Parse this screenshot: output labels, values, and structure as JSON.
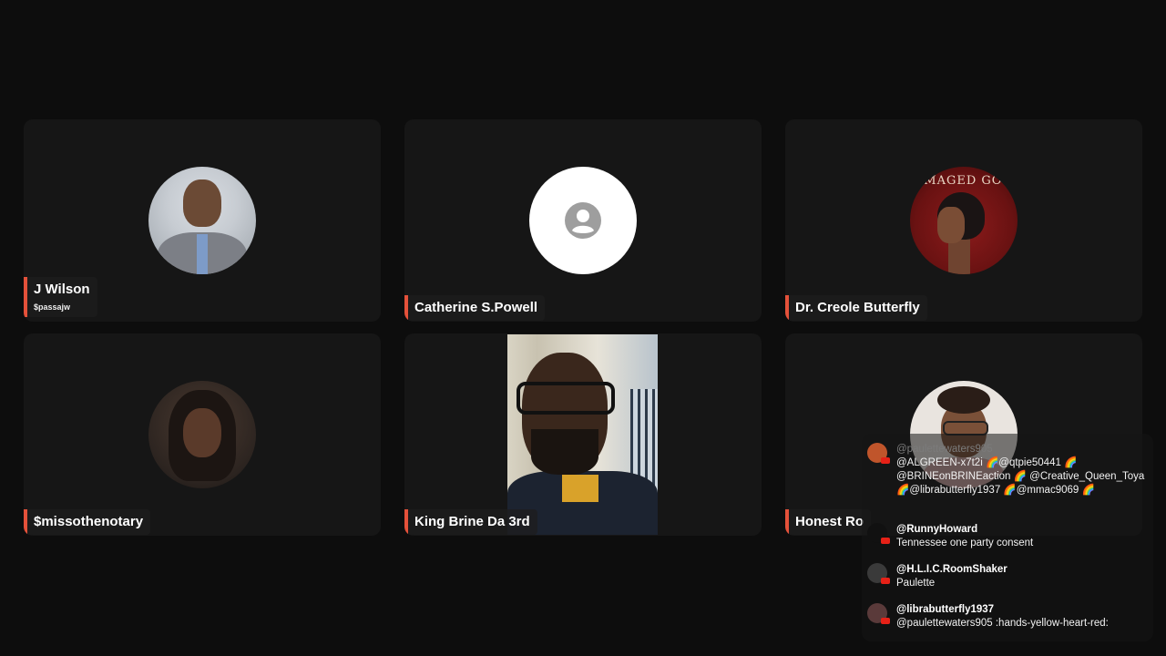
{
  "participants": [
    {
      "name": "J Wilson",
      "handle": "$passajw"
    },
    {
      "name": "Catherine S.Powell"
    },
    {
      "name": "Dr. Creole Butterfly",
      "avatar_text": "AMAGED GOO"
    },
    {
      "name": "$missothenotary"
    },
    {
      "name": "King Brine Da 3rd"
    },
    {
      "name": "Honest Ro"
    }
  ],
  "chat": {
    "messages": [
      {
        "user": "@paulettewaters905",
        "text": "@ALGREEN-x7t2i 🌈@qtpie50441 🌈 @BRINEonBRINEaction 🌈 @Creative_Queen_Toya 🌈@librabutterfly1937 🌈@mmac9069 🌈"
      },
      {
        "user": "@RunnyHoward",
        "text": "Tennessee one party consent"
      },
      {
        "user": "@H.L.I.C.RoomShaker",
        "text": "Paulette"
      },
      {
        "user": "@librabutterfly1937",
        "text": "@paulettewaters905 :hands-yellow-heart-red:"
      }
    ]
  },
  "colors": {
    "background": "#0d0d0d",
    "tile": "#161616",
    "accent": "#e4513a",
    "youtube_badge": "#e62117"
  },
  "icons": {
    "placeholder_avatar": "user-circle-icon",
    "chat_source": "youtube-icon"
  }
}
